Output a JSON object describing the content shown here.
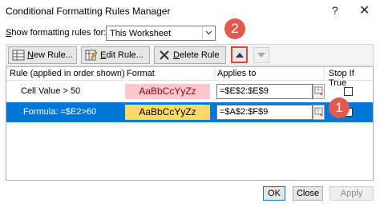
{
  "window": {
    "title": "Conditional Formatting Rules Manager",
    "help_glyph": "?",
    "close_glyph": "✕"
  },
  "show_rules": {
    "label": "Show formatting rules for:",
    "label_hotkey": "S",
    "label_rest": "how formatting rules for:",
    "selected": "This Worksheet"
  },
  "toolbar": {
    "new_hotkey": "N",
    "new_rest": "ew Rule...",
    "edit_hotkey": "E",
    "edit_rest": "dit Rule...",
    "delete_hotkey": "D",
    "delete_rest": "elete Rule"
  },
  "table": {
    "headers": {
      "rule": "Rule (applied in order shown)",
      "format": "Format",
      "applies": "Applies to",
      "stop": "Stop If True"
    },
    "rows": [
      {
        "rule": "Cell Value > 50",
        "format_preview": "AaBbCcYyZz",
        "applies_to": "=$E$2:$E$9",
        "stop_if_true": false,
        "selected": false
      },
      {
        "rule": "Formula: =$E2>60",
        "format_preview": "AaBbCcYyZz",
        "applies_to": "=$A$2:$F$9",
        "stop_if_true": false,
        "selected": true
      }
    ]
  },
  "callouts": {
    "step1": "1",
    "step2": "2"
  },
  "footer": {
    "ok": "OK",
    "close": "Close",
    "apply": "Apply"
  },
  "colors": {
    "selection": "#0078d7",
    "callout": "#e05a4f",
    "fmt1_fill": "#ffc7ce",
    "fmt1_text": "#9c0006",
    "fmt2_fill": "#ffd966"
  }
}
